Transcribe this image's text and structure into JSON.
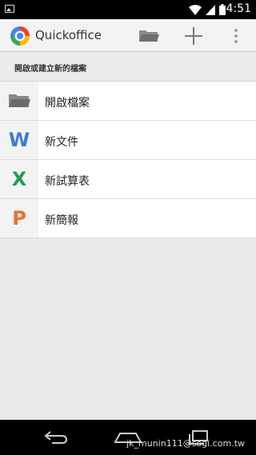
{
  "status_bar": {
    "time": "4:51"
  },
  "app_bar": {
    "title": "Quickoffice",
    "actions": [
      "folder-icon",
      "add-icon",
      "overflow-menu-icon"
    ]
  },
  "section": {
    "header": "開啟或建立新的檔案"
  },
  "items": [
    {
      "label": "開啟檔案",
      "icon": "folder-icon"
    },
    {
      "label": "新文件",
      "icon": "word-document-icon",
      "icon_text": "W",
      "color": "#3d7bd6"
    },
    {
      "label": "新試算表",
      "icon": "spreadsheet-icon",
      "icon_text": "X",
      "color": "#1e9e5a"
    },
    {
      "label": "新簡報",
      "icon": "presentation-icon",
      "icon_text": "P",
      "color": "#ee6f2b"
    }
  ],
  "nav_bar": {
    "buttons": [
      "back-icon",
      "home-icon",
      "recent-apps-icon"
    ]
  },
  "watermark": "jk_munin111@sogi.com.tw"
}
